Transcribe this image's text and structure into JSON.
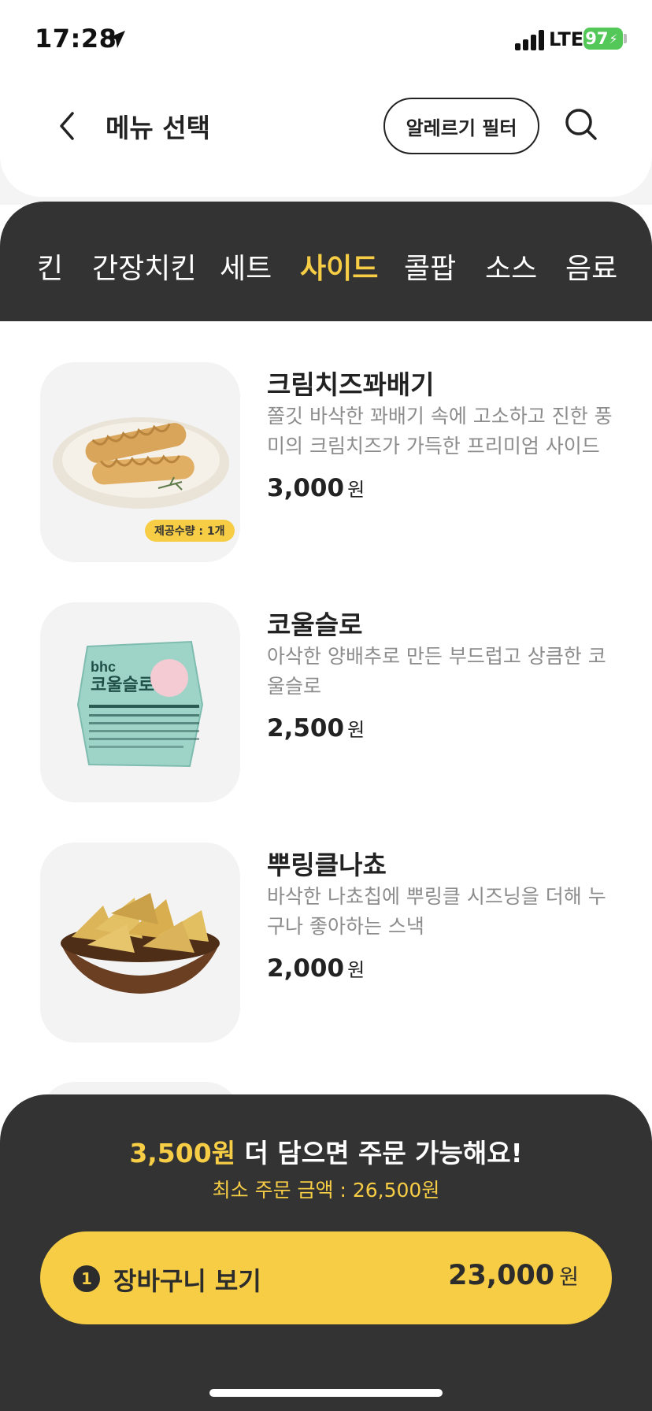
{
  "status_bar": {
    "time": "17:28",
    "network": "LTE",
    "battery": "97"
  },
  "header": {
    "title": "메뉴 선택",
    "allergy_filter_label": "알레르기 필터"
  },
  "categories": [
    {
      "label": "킨",
      "active": false
    },
    {
      "label": "간장치킨",
      "active": false
    },
    {
      "label": "세트",
      "active": false
    },
    {
      "label": "사이드",
      "active": true
    },
    {
      "label": "콜팝",
      "active": false
    },
    {
      "label": "소스",
      "active": false
    },
    {
      "label": "음료",
      "active": false
    }
  ],
  "menu_items": [
    {
      "name": "크림치즈꽈배기",
      "description": "쫄깃 바삭한 꽈배기 속에 고소하고 진한 풍미의 크림치즈가 가득한 프리미엄 사이드",
      "price": "3,000",
      "currency": "원",
      "badge": "제공수량 : 1개"
    },
    {
      "name": "코울슬로",
      "description": "아삭한 양배추로 만든 부드럽고 상큼한 코울슬로",
      "price": "2,500",
      "currency": "원",
      "image_brand_text": "bhc",
      "image_title_text": "코울슬로"
    },
    {
      "name": "뿌링클나쵸",
      "description": "바삭한 나쵸칩에 뿌링클 시즈닝을 더해 누구나 좋아하는 스낵",
      "price": "2,000",
      "currency": "원"
    }
  ],
  "bottom_sheet": {
    "shortfall_amount": "3,500원",
    "shortfall_text": " 더 담으면 주문 가능해요!",
    "min_order": "최소 주문 금액 : 26,500원",
    "cart_count": "1",
    "cart_label": "장바구니 보기",
    "cart_total": "23,000",
    "currency": "원"
  },
  "colors": {
    "accent": "#f6cd45",
    "dark": "#333333",
    "battery": "#54c759"
  }
}
